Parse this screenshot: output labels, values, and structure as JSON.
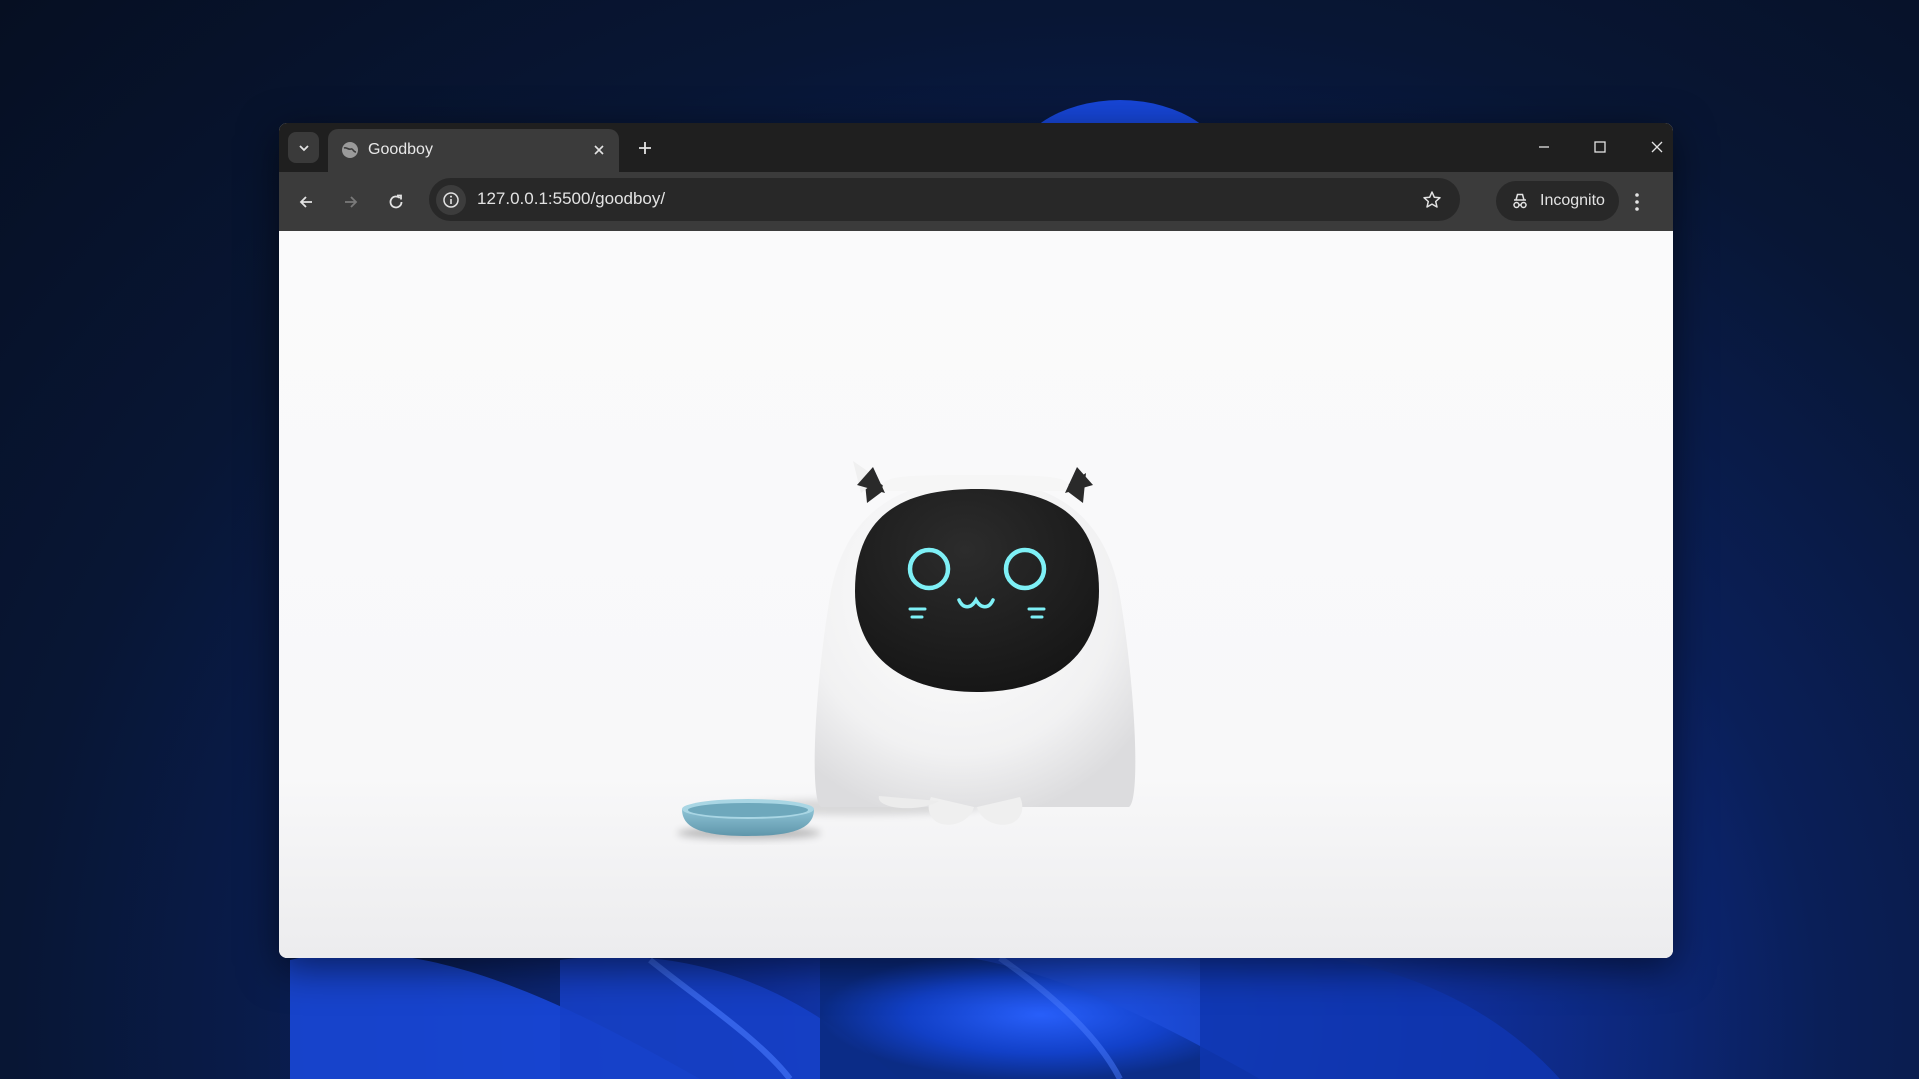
{
  "browser": {
    "tab": {
      "title": "Goodboy",
      "favicon": "globe-icon",
      "close_icon": "close-icon"
    },
    "new_tab_icon": "plus-icon",
    "window_controls": [
      "minimize-icon",
      "maximize-icon",
      "close-icon"
    ],
    "toolbar": {
      "back_icon": "arrow-left-icon",
      "forward_icon": "arrow-right-icon",
      "reload_icon": "reload-icon",
      "url": "127.0.0.1:5500/goodboy/",
      "site_info_icon": "info-icon",
      "bookmark_icon": "star-icon",
      "profile_label": "Incognito",
      "menu_icon": "kebab-menu-icon"
    }
  },
  "page": {
    "character": "white-cat-robot",
    "face_color": "#1d1d1d",
    "eye_color": "#7ef0f6",
    "bowl_color": "#7fb6c9"
  },
  "colors": {
    "titlebar": "#1f1f1f",
    "toolbar": "#3b3b3b",
    "omnibox": "#282828",
    "page_background": "#f8f8f9"
  }
}
